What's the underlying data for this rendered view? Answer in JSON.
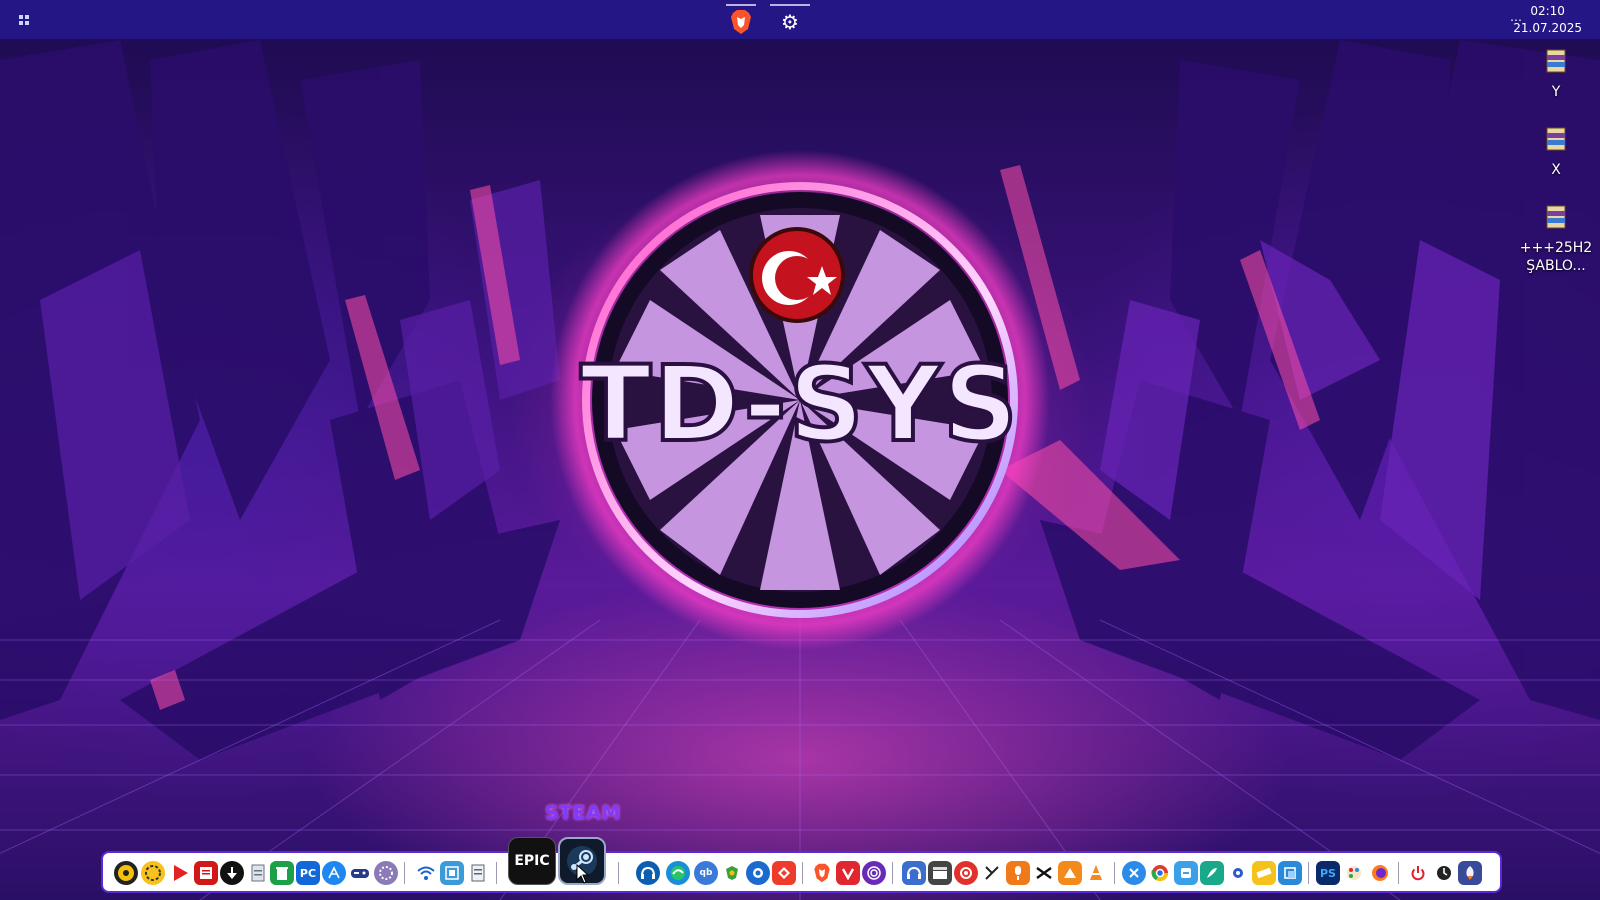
{
  "topbar": {
    "menu_icon": "grid-menu-icon",
    "pinned": [
      {
        "icon": "brave-browser-icon"
      },
      {
        "icon": "gear-icon"
      }
    ],
    "tray_overflow": "⋯",
    "clock": {
      "time": "02:10",
      "date": "21.07.2025"
    }
  },
  "wallpaper": {
    "logo_text": "TD-SYS",
    "flag_icon": "turkish-flag-icon",
    "colors": {
      "ring": "#ff66cc",
      "accent": "#7a3cff"
    }
  },
  "desktop_icons": [
    {
      "label": "Y",
      "icon": "winrar-archive-icon"
    },
    {
      "label": "X",
      "icon": "winrar-archive-icon"
    },
    {
      "label": "+++25H2 ŞABLO...",
      "icon": "winrar-archive-icon"
    }
  ],
  "dock": {
    "hover_label": "STEAM",
    "groups": [
      [
        "disc-icon",
        "spinner-icon",
        "youtube-icon",
        "document-reader-icon",
        "download-icon",
        "file-icon",
        "recycle-bin-icon",
        "pc-icon",
        "app-store-icon",
        "gamepad-icon",
        "settings-sphere-icon"
      ],
      [
        "wifi-icon",
        "remote-desktop-icon",
        "notepad-icon"
      ],
      [
        "epic-games-icon",
        "steam-icon"
      ],
      [
        "headset-icon",
        "edge-icon",
        "qbittorrent-icon",
        "shield-icon",
        "thunderbird-icon",
        "anydesk-icon"
      ],
      [
        "brave-icon",
        "vivaldi-icon",
        "tor-icon"
      ],
      [
        "headphones-icon",
        "clapper-icon",
        "record-icon",
        "scissors-icon",
        "microphone-icon",
        "capcut-icon",
        "triangle-icon",
        "vlc-icon"
      ],
      [
        "tool-icon",
        "chrome-icon",
        "storage-icon",
        "feather-icon",
        "dot-icon",
        "ruler-icon",
        "screen-icon"
      ],
      [
        "photoshop-icon",
        "paint-icon",
        "firefox-icon"
      ],
      [
        "power-icon",
        "clock-icon",
        "rocket-icon"
      ]
    ],
    "epic_text": "EPIC",
    "pc_text": "PC",
    "ps_text": "PS"
  }
}
